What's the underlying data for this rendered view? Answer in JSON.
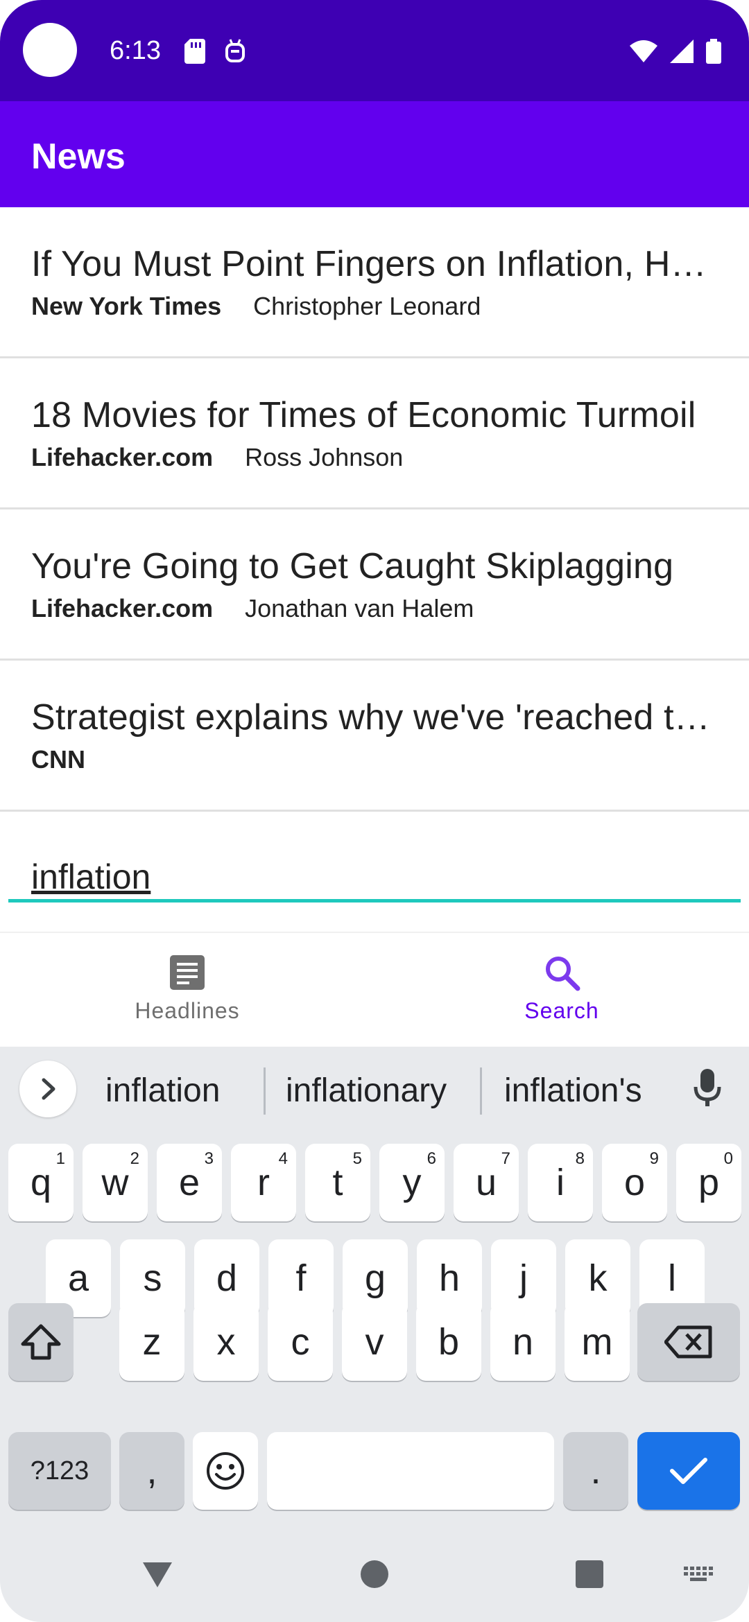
{
  "status": {
    "time": "6:13"
  },
  "app_bar": {
    "title": "News"
  },
  "articles": [
    {
      "title": "If You Must Point Fingers on Inflation, Here's Where to Look",
      "source": "New York Times",
      "author": "Christopher Leonard"
    },
    {
      "title": "18 Movies for Times of Economic Turmoil",
      "source": "Lifehacker.com",
      "author": "Ross Johnson"
    },
    {
      "title": "You're Going to Get Caught Skiplagging",
      "source": "Lifehacker.com",
      "author": "Jonathan van Halem"
    },
    {
      "title": "Strategist explains why we've 'reached the peak'",
      "source": "CNN",
      "author": ""
    }
  ],
  "search": {
    "value": "inflation"
  },
  "bottom_nav": [
    {
      "label": "Headlines",
      "icon": "article-icon",
      "active": false
    },
    {
      "label": "Search",
      "icon": "search-icon",
      "active": true
    }
  ],
  "keyboard": {
    "suggestions": [
      "inflation",
      "inflationary",
      "inflation's"
    ],
    "row1": [
      {
        "k": "q",
        "n": "1"
      },
      {
        "k": "w",
        "n": "2"
      },
      {
        "k": "e",
        "n": "3"
      },
      {
        "k": "r",
        "n": "4"
      },
      {
        "k": "t",
        "n": "5"
      },
      {
        "k": "y",
        "n": "6"
      },
      {
        "k": "u",
        "n": "7"
      },
      {
        "k": "i",
        "n": "8"
      },
      {
        "k": "o",
        "n": "9"
      },
      {
        "k": "p",
        "n": "0"
      }
    ],
    "row2": [
      "a",
      "s",
      "d",
      "f",
      "g",
      "h",
      "j",
      "k",
      "l"
    ],
    "row3": [
      "z",
      "x",
      "c",
      "v",
      "b",
      "n",
      "m"
    ],
    "symbols_label": "?123",
    "comma": ",",
    "period": "."
  },
  "colors": {
    "status_bar": "#3e00b3",
    "app_bar": "#6200ee",
    "accent": "#6200ee",
    "input_underline": "#1ec9bd",
    "enter_key": "#1a73e8"
  }
}
